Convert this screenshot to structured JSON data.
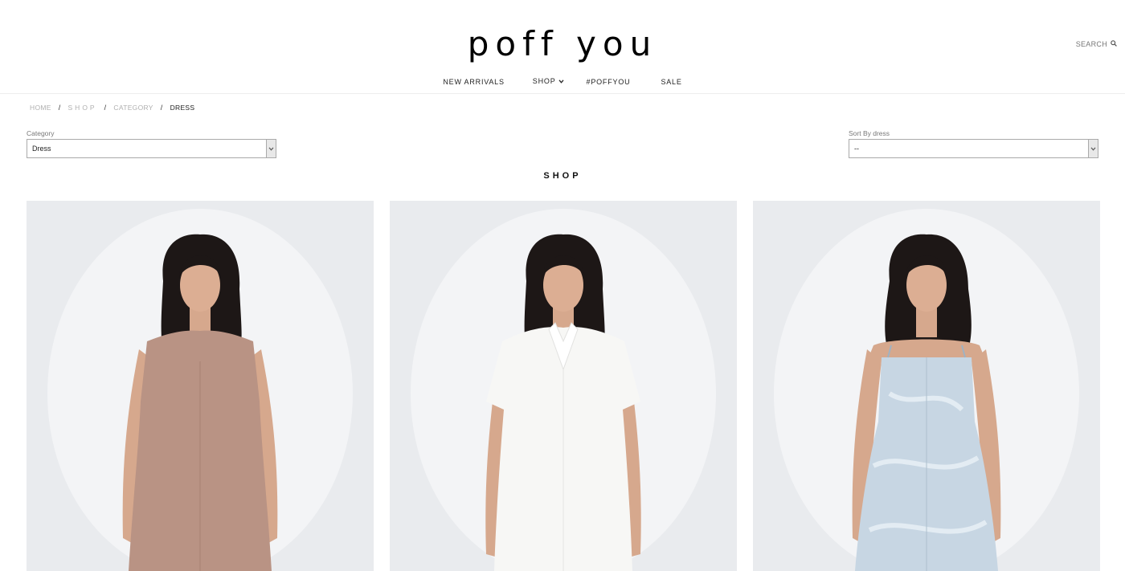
{
  "brand": {
    "logo": "poff you"
  },
  "header": {
    "search_label": "SEARCH"
  },
  "nav": {
    "items": [
      {
        "label": "NEW ARRIVALS"
      },
      {
        "label": "SHOP"
      },
      {
        "label": "#POFFYOU"
      },
      {
        "label": "SALE"
      }
    ]
  },
  "breadcrumb": {
    "items": [
      "HOME",
      "SHOP",
      "CATEGORY"
    ],
    "separator": "/",
    "current": "DRESS"
  },
  "filters": {
    "category": {
      "label": "Category",
      "value": "Dress"
    },
    "sort": {
      "label": "Sort By dress",
      "value": "--"
    }
  },
  "main": {
    "title": "SHOP"
  },
  "products": [
    {
      "image": "model-in-taupe-sleeveless-dress",
      "dress_color": "#b99384"
    },
    {
      "image": "model-in-white-collared-shirt-dress",
      "dress_color": "#f7f7f5"
    },
    {
      "image": "model-in-light-blue-print-strap-dress",
      "dress_color": "#c7d6e3"
    }
  ],
  "colors": {
    "text": "#222222",
    "muted": "#b0b0b0",
    "photo_bg": "#e9ebee",
    "skin": "#d6a88d",
    "hair": "#1d1716"
  }
}
